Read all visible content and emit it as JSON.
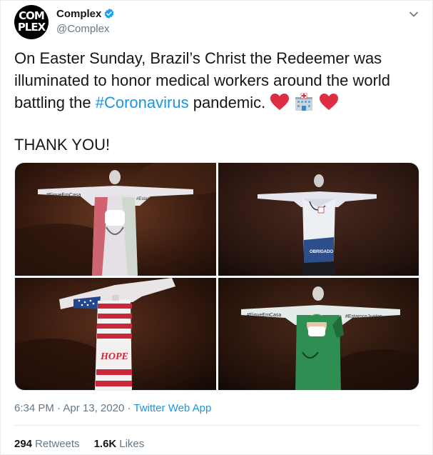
{
  "author": {
    "avatar_text_line1": "COM",
    "avatar_text_line2": "PLEX",
    "display_name": "Complex",
    "handle": "@Complex",
    "verified": true
  },
  "tweet": {
    "text_part1": "On Easter Sunday, Brazil’s Christ the Redeemer was illuminated to honor medical workers around the world battling the ",
    "hashtag": "#Coronavirus",
    "text_part2": " pandemic.",
    "emojis": [
      "red-heart",
      "hospital",
      "red-heart"
    ],
    "second_paragraph": "THANK YOU!"
  },
  "media": {
    "images": [
      {
        "name": "christ-statue-italy-flag-doctor",
        "overlay_left": "#FiqueEmCasa",
        "overlay_right": "#EstamosJuntos"
      },
      {
        "name": "christ-statue-doctor-coat",
        "overlay_text": "OBRIGADO"
      },
      {
        "name": "christ-statue-usa-flag",
        "overlay_text": "HOPE"
      },
      {
        "name": "christ-statue-nurse-green",
        "overlay_left": "#FiqueEmCasa",
        "overlay_right": "#EstamosJuntos"
      }
    ]
  },
  "meta": {
    "time": "6:34 PM",
    "separator": " · ",
    "date": "Apr 13, 2020",
    "source": "Twitter Web App"
  },
  "stats": {
    "retweets_count": "294",
    "retweets_label": "Retweets",
    "likes_count": "1.6K",
    "likes_label": "Likes"
  },
  "colors": {
    "link": "#1b95e0",
    "secondary_text": "#657786",
    "border": "#e6ecf0",
    "verified_blue": "#1da1f2"
  }
}
